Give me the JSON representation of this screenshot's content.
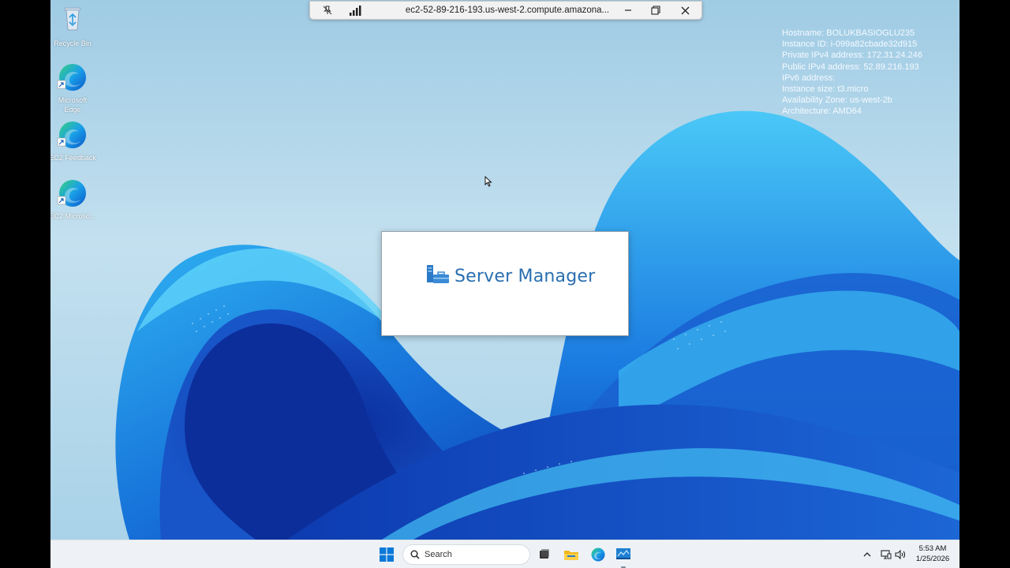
{
  "connection_bar": {
    "title": "ec2-52-89-216-193.us-west-2.compute.amazona...",
    "pin_icon": "unpin-icon",
    "signal_icon": "signal-bars-icon",
    "minimize_icon": "minimize-icon",
    "restore_icon": "restore-icon",
    "close_icon": "close-icon"
  },
  "sysinfo": {
    "lines": [
      "Hostname: BOLUKBASIOGLU235",
      "Instance ID: i-099a82cbade32d915",
      "Private IPv4 address: 172.31.24.246",
      "Public IPv4 address: 52.89.216.193",
      "IPv6 address:",
      "Instance size: t3.micro",
      "Availability Zone: us-west-2b",
      "Architecture: AMD64"
    ]
  },
  "desktop_icons": [
    {
      "label": "Recycle Bin",
      "icon": "recycle-bin-icon"
    },
    {
      "label": "Microsoft Edge",
      "icon": "edge-icon"
    },
    {
      "label": "EC2 Feedback",
      "icon": "edge-icon"
    },
    {
      "label": "EC2 Microso...",
      "icon": "edge-icon"
    }
  ],
  "splash": {
    "title": "Server Manager",
    "icon": "server-manager-icon"
  },
  "taskbar": {
    "start_icon": "windows-start-icon",
    "search_placeholder": "Search",
    "pinned": [
      "task-view-icon",
      "file-explorer-icon",
      "edge-icon",
      "server-manager-icon"
    ],
    "tray": [
      "chevron-up-icon",
      "network-icon",
      "volume-icon"
    ],
    "time": "5:53 AM",
    "date": "1/25/2026"
  },
  "colors": {
    "accent": "#2a6fb0",
    "start_blue": "#0078d4"
  }
}
